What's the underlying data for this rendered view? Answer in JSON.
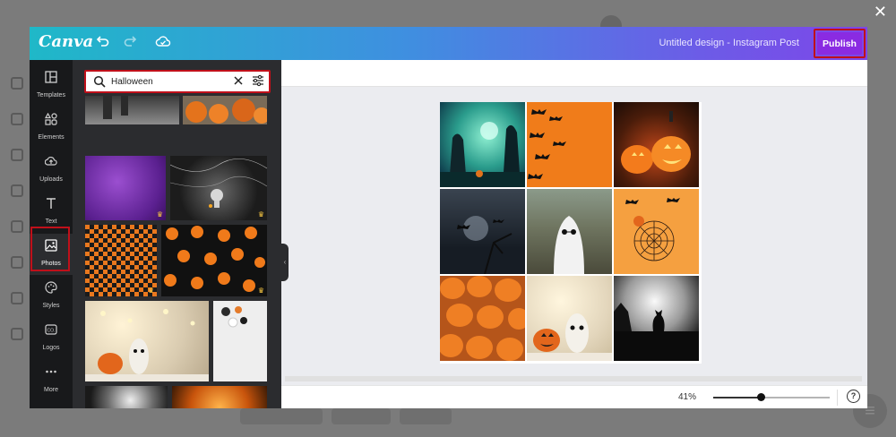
{
  "app": {
    "logo": "Canva",
    "design_title": "Untitled design - Instagram Post"
  },
  "toolbar": {
    "undo_icon": "undo-icon",
    "redo_icon": "redo-icon",
    "save_icon": "cloud-icon",
    "publish_label": "Publish"
  },
  "nav": {
    "items": [
      {
        "label": "Templates",
        "icon": "templates-icon"
      },
      {
        "label": "Elements",
        "icon": "elements-icon"
      },
      {
        "label": "Uploads",
        "icon": "uploads-icon"
      },
      {
        "label": "Text",
        "icon": "text-icon"
      },
      {
        "label": "Photos",
        "icon": "photos-icon"
      },
      {
        "label": "Styles",
        "icon": "styles-icon"
      },
      {
        "label": "Logos",
        "icon": "logos-icon"
      },
      {
        "label": "More",
        "icon": "more-icon"
      }
    ],
    "active": "Photos"
  },
  "search": {
    "value": "Halloween"
  },
  "zoom": {
    "label": "41%",
    "level": 0.41
  },
  "footer": {
    "help_label": "?"
  },
  "colors": {
    "accent": "#8a2be2",
    "highlight": "#c0101a",
    "panel": "#2b2c2f",
    "nav": "#18191b"
  }
}
